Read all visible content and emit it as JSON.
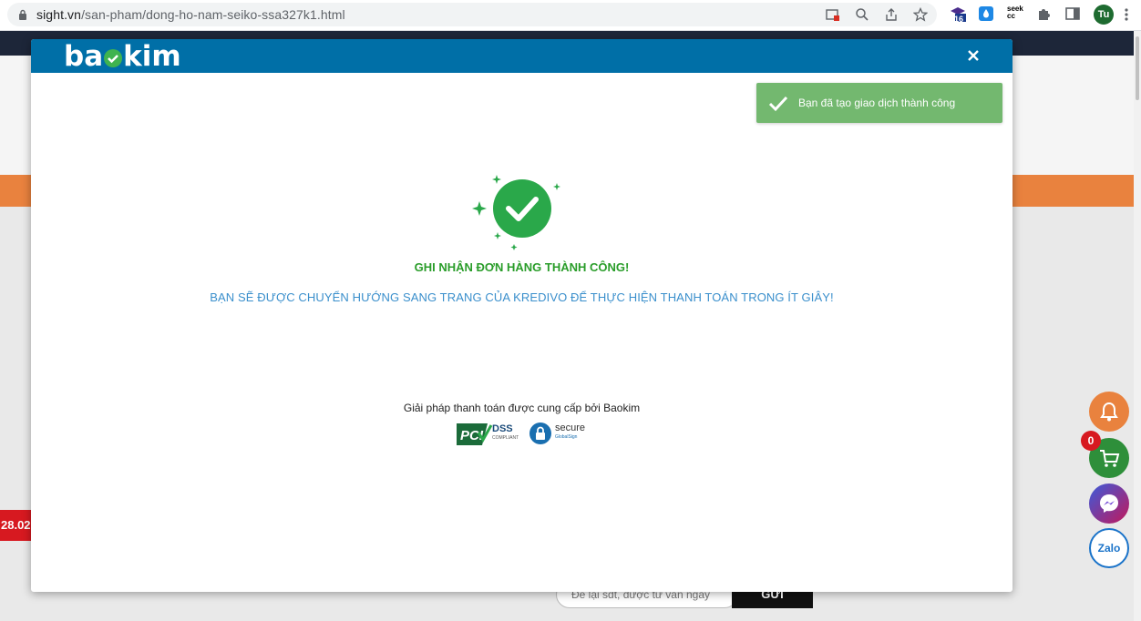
{
  "browser": {
    "url_host": "sight.vn",
    "url_path": "/san-pham/dong-ho-nam-seiko-ssa327k1.html",
    "extension_badge": "16",
    "seek_ext_label": "seek cc",
    "profile_initials": "Tu"
  },
  "background": {
    "tag_text": "28.02",
    "phone_placeholder": "Để lại sđt, được tư vấn ngay",
    "submit_label": "GỬI",
    "cart_count": "0",
    "zalo_label": "Zalo"
  },
  "modal": {
    "logo_text_pre": "ba",
    "logo_text_post": "kim",
    "toast_message": "Bạn đã tạo giao dịch thành công",
    "title": "GHI NHẬN ĐƠN HÀNG THÀNH CÔNG!",
    "subtitle": "BẠN SẼ ĐƯỢC CHUYỂN HƯỚNG SANG TRANG CỦA KREDIVO ĐỂ THỰC HIỆN THANH TOÁN TRONG ÍT GIÂY!",
    "provided_by": "Giải pháp thanh toán được cung cấp bởi Baokim",
    "pci_text": "DSS",
    "pci_sub": "COMPLIANT",
    "secure_text": "secure",
    "secure_sub": "GlobalSign"
  },
  "colors": {
    "header_blue": "#006fa7",
    "success_green": "#2a9d2a",
    "subtitle_blue": "#3a8fcc",
    "toast_green": "#73b86f"
  }
}
